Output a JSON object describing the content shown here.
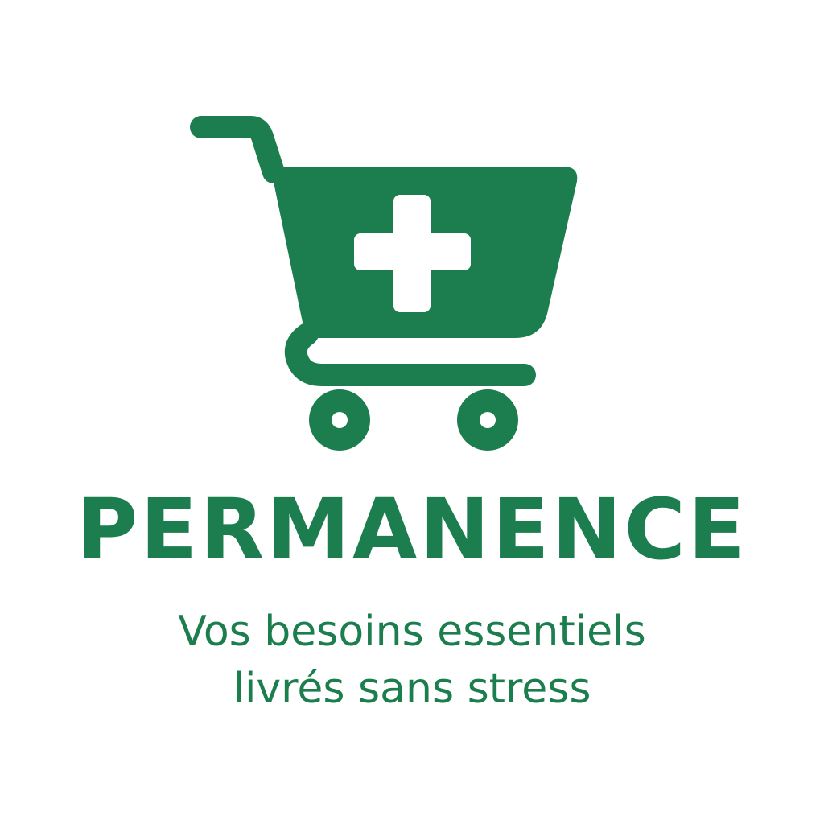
{
  "brand": {
    "name": "PERMANENCE",
    "tagline_line1": "Vos besoins essentiels",
    "tagline_line2": "livrés sans stress"
  },
  "icon": {
    "name": "shopping-cart-plus-icon"
  },
  "colors": {
    "primary_green": "#1c7e4e",
    "background": "#ffffff"
  }
}
